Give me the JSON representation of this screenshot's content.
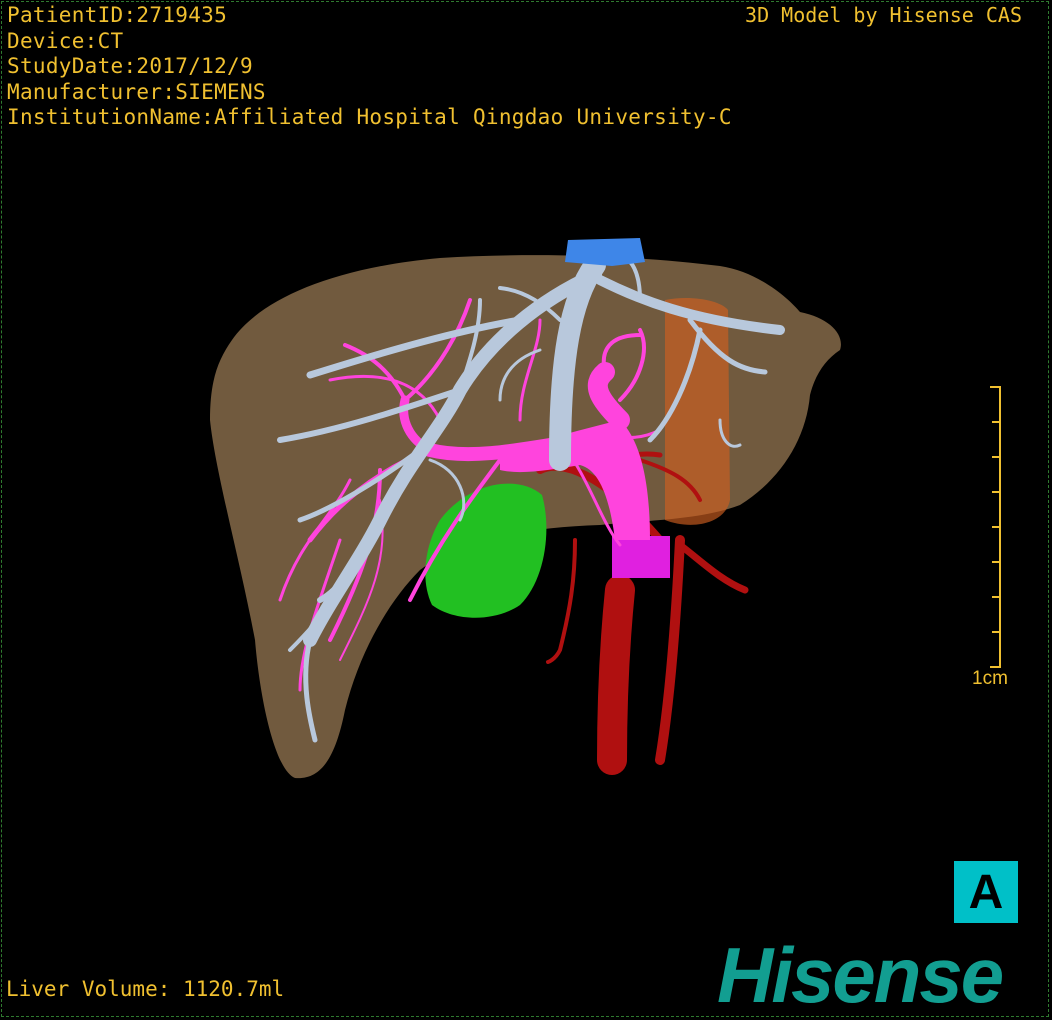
{
  "info": {
    "patient_id": "PatientID:2719435",
    "device": "Device:CT",
    "study_date": "StudyDate:2017/12/9",
    "manufacturer": "Manufacturer:SIEMENS",
    "institution": "InstitutionName:Affiliated Hospital Qingdao University-C"
  },
  "credit": "3D Model by Hisense CAS",
  "scale_label": "1cm",
  "orientation_button": "A",
  "brand": "Hisense",
  "liver_volume": "Liver Volume: 1120.7ml",
  "colors": {
    "overlay_text": "#f0c030",
    "liver": "#8a6e4c",
    "hepatic_vein": "#b8c8dc",
    "portal_vein": "#ff44dd",
    "artery": "#b01010",
    "gallbladder": "#22c022",
    "ivc_cap": "#3e86e8",
    "orientation_bg": "#00c0c8",
    "brand": "#129e91"
  }
}
